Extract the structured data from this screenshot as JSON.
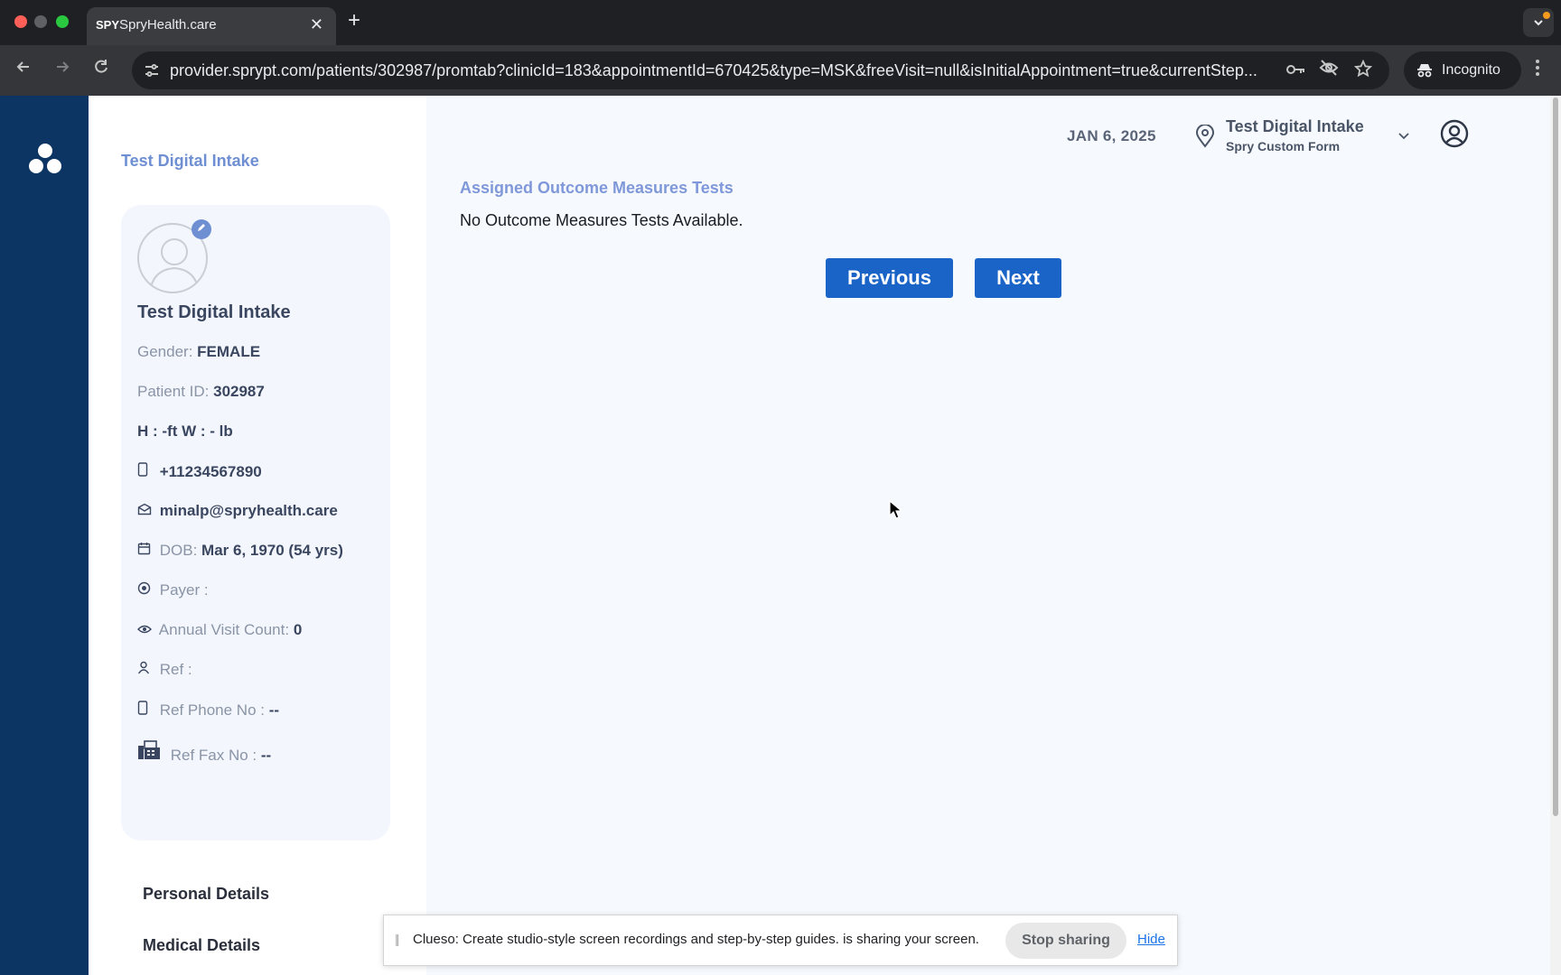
{
  "browser": {
    "tab_title": "SpryHealth.care",
    "tab_favicon": "SPY",
    "tab_close": "✕",
    "new_tab": "+",
    "url": "provider.sprypt.com/patients/302987/promtab?clinicId=183&appointmentId=670425&type=MSK&freeVisit=null&isInitialAppointment=true&currentStep...",
    "incognito_label": "Incognito",
    "icons": [
      "back-arrow-icon",
      "forward-arrow-icon",
      "reload-icon",
      "site-info-icon",
      "password-key-icon",
      "eye-off-icon",
      "star-icon",
      "incognito-icon",
      "more-vert-icon"
    ]
  },
  "sidebar": {
    "breadcrumb": "Test Digital Intake",
    "patient": {
      "name": "Test Digital Intake",
      "gender_label": "Gender:",
      "gender": "FEMALE",
      "patient_id_label": "Patient ID:",
      "patient_id": "302987",
      "height_weight": "H : -ft W : - lb",
      "phone": "+11234567890",
      "email": "minalp@spryhealth.care",
      "dob_label": "DOB:",
      "dob": "Mar 6, 1970 (54 yrs)",
      "payer_label": "Payer :",
      "payer": "",
      "visit_count_label": "Annual Visit Count:",
      "visit_count": "0",
      "ref_label": "Ref :",
      "ref": "",
      "ref_phone_label": "Ref Phone No :",
      "ref_phone": "--",
      "ref_fax_label": "Ref Fax No :",
      "ref_fax": "--"
    },
    "menu": [
      "Personal Details",
      "Medical Details"
    ]
  },
  "header": {
    "date": "JAN 6, 2025",
    "location_name": "Test Digital Intake",
    "location_form": "Spry Custom Form"
  },
  "main": {
    "section_title": "Assigned Outcome Measures Tests",
    "empty_message": "No Outcome Measures Tests Available.",
    "previous_label": "Previous",
    "next_label": "Next"
  },
  "sharebar": {
    "message": "Clueso: Create studio-style screen recordings and step-by-step guides. is sharing your screen.",
    "stop_label": "Stop sharing",
    "hide_label": "Hide"
  },
  "colors": {
    "rail": "#0c3564",
    "primary_button": "#1a64c7",
    "accent_text": "#7f98d9"
  }
}
